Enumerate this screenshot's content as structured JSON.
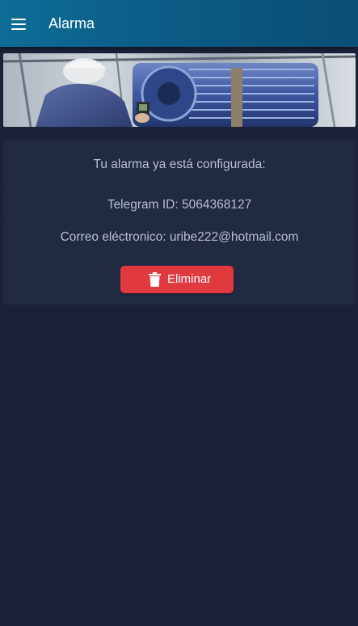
{
  "header": {
    "title": "Alarma",
    "menu_icon": "hamburger-menu-icon"
  },
  "banner": {
    "description_icon": "industrial-motor-photo"
  },
  "alarm": {
    "configured_text": "Tu alarma ya está configurada:",
    "telegram_text": "Telegram ID: 5064368127",
    "email_text": "Correo eléctronico: uribe222@hotmail.com",
    "delete_label": "Eliminar",
    "delete_icon": "trash-icon"
  },
  "colors": {
    "header": "#0b5c86",
    "background": "#1b2237",
    "card": "#222a42",
    "text": "#b7bfcf",
    "danger": "#e0393e"
  }
}
